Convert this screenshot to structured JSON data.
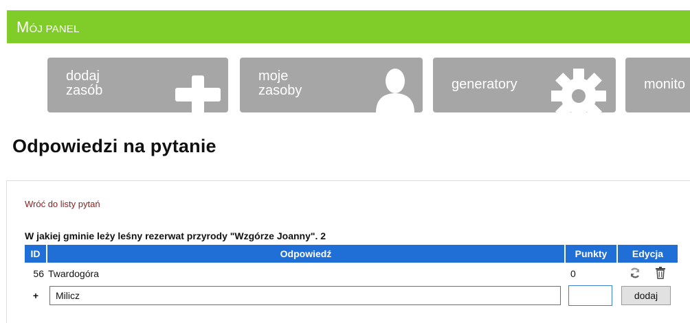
{
  "header": {
    "title_first": "M",
    "title_rest": "ÓJ PANEL"
  },
  "tiles": [
    {
      "line1": "dodaj",
      "line2": "zasób",
      "icon": "plus-icon"
    },
    {
      "line1": "moje",
      "line2": "zasoby",
      "icon": "user-icon"
    },
    {
      "line1": "generatory",
      "icon": "gear-icon"
    },
    {
      "line1": "monito",
      "icon": "monitor-icon"
    }
  ],
  "page": {
    "title": "Odpowiedzi na pytanie",
    "back_link": "Wróć do listy pytań"
  },
  "question": "W jakiej gminie leży leśny rezerwat przyrody \"Wzgórze Joanny\". 2",
  "table": {
    "headers": {
      "id": "ID",
      "answer": "Odpowiedź",
      "points": "Punkty",
      "edit": "Edycja"
    },
    "rows": [
      {
        "id": "56",
        "answer": "Twardogóra",
        "points": "0"
      }
    ],
    "new_row": {
      "marker": "+",
      "answer_value": "Milicz",
      "points_value": "",
      "add_label": "dodaj"
    }
  },
  "colors": {
    "header_bar": "#80cc28",
    "tile": "#a6a6a6",
    "table_header": "#1f6fd6",
    "link": "#8a1c1c"
  }
}
